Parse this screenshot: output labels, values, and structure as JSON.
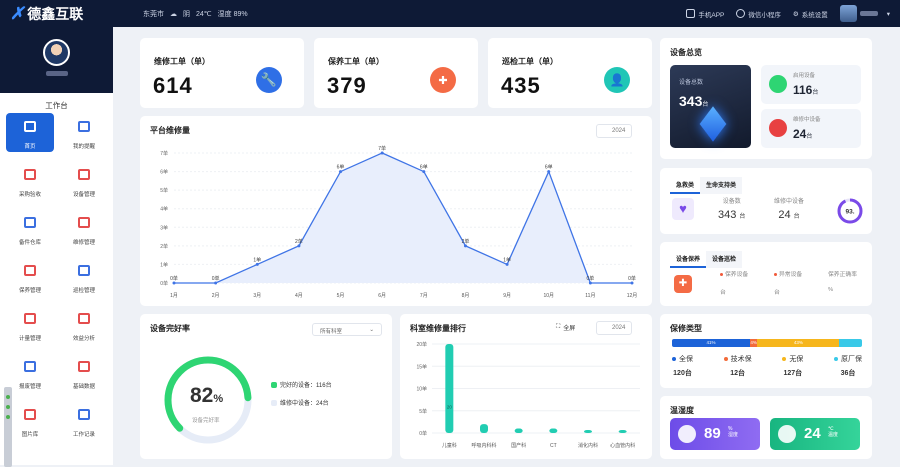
{
  "header": {
    "brand": "德鑫互联",
    "city": "东莞市",
    "weather": "阴",
    "temp": "24℃",
    "humidity": "湿度 89%",
    "app": "手机APP",
    "mini": "微信小程序",
    "settings": "系统设置"
  },
  "sidebar": {
    "workbench": "工作台",
    "items": [
      {
        "label": "首页",
        "icon": "home-icon"
      },
      {
        "label": "我的提醒",
        "icon": "alarm-icon"
      },
      {
        "label": "采购验收",
        "icon": "clipboard-check-icon"
      },
      {
        "label": "设备管理",
        "icon": "device-icon"
      },
      {
        "label": "备件仓库",
        "icon": "warehouse-icon"
      },
      {
        "label": "维修管理",
        "icon": "repair-icon"
      },
      {
        "label": "保养管理",
        "icon": "maintenance-icon"
      },
      {
        "label": "巡检管理",
        "icon": "inspection-icon"
      },
      {
        "label": "计量管理",
        "icon": "meter-icon"
      },
      {
        "label": "效益分析",
        "icon": "analysis-icon"
      },
      {
        "label": "报废管理",
        "icon": "scrap-icon"
      },
      {
        "label": "基础数据",
        "icon": "database-icon"
      },
      {
        "label": "图片库",
        "icon": "gallery-icon"
      },
      {
        "label": "工作记录",
        "icon": "record-icon"
      }
    ]
  },
  "kpis": [
    {
      "label": "维修工单（单）",
      "value": "614",
      "color": "#2f6fe6"
    },
    {
      "label": "保养工单（单）",
      "value": "379",
      "color": "#f46b45"
    },
    {
      "label": "巡检工单（单）",
      "value": "435",
      "color": "#20c6b6"
    }
  ],
  "repair_chart": {
    "title": "平台维修量",
    "year": "2024",
    "ylabels": [
      "0单",
      "1单",
      "2单",
      "3单",
      "4单",
      "5单",
      "6单",
      "7单"
    ]
  },
  "chart_data": [
    {
      "type": "area",
      "title": "平台维修量",
      "categories": [
        "1月",
        "2月",
        "3月",
        "4月",
        "5月",
        "6月",
        "7月",
        "8月",
        "9月",
        "10月",
        "11月",
        "12月"
      ],
      "values": [
        0,
        0,
        1,
        2,
        6,
        7,
        6,
        2,
        1,
        6,
        0,
        0
      ],
      "unit": "单",
      "ylim": [
        0,
        7
      ]
    },
    {
      "type": "bar",
      "title": "科室维修量排行",
      "categories": [
        "儿童科",
        "呼吸内科科",
        "国产科",
        "CT",
        "消化内科",
        "心血管内科"
      ],
      "values": [
        20,
        2,
        1,
        1,
        0,
        0
      ],
      "ylim": [
        0,
        20
      ]
    }
  ],
  "dept_chart": {
    "title": "科室维修量排行",
    "fullscreen": "全屏",
    "year": "2024",
    "ylabels": [
      "0单",
      "5单",
      "10单",
      "15单",
      "20单"
    ],
    "bar_label": "20"
  },
  "health": {
    "title": "设备完好率",
    "select": "所有科室",
    "value": "82",
    "unit": "%",
    "sub": "设备完好率",
    "legend": [
      {
        "label": "完好的设备：116台",
        "color": "#2ed573"
      },
      {
        "label": "维修中设备：24台",
        "color": "#e6ecf7"
      }
    ]
  },
  "overview": {
    "title": "设备总览",
    "total_label": "设备总数",
    "total": "343",
    "unit": "台",
    "enabled_label": "启用设备",
    "enabled": "116",
    "repair_label": "维修中设备",
    "repairing": "24"
  },
  "emergency": {
    "tabs": [
      "急救类",
      "生命支持类"
    ],
    "count_label": "设备数",
    "count": "343",
    "repair_label": "维修中设备",
    "repair": "24",
    "unit": "台",
    "ring": "93."
  },
  "maint": {
    "tabs": [
      "设备保养",
      "设备巡检"
    ],
    "labels": [
      "保养设备",
      "异常设备",
      "保养正确率"
    ],
    "units": [
      "台",
      "台",
      "%"
    ]
  },
  "guarantee": {
    "title": "保修类型",
    "bar": [
      {
        "pct": "41%",
        "color": "#1d63d8",
        "w": 41
      },
      {
        "pct": "4%",
        "color": "#f26b3a",
        "w": 4
      },
      {
        "pct": "43%",
        "color": "#f6b61d",
        "w": 43
      },
      {
        "pct": "",
        "color": "#39c9e8",
        "w": 12
      }
    ],
    "items": [
      {
        "name": "全保",
        "value": "120台",
        "color": "#1d63d8"
      },
      {
        "name": "技术保",
        "value": "12台",
        "color": "#f26b3a"
      },
      {
        "name": "无保",
        "value": "127台",
        "color": "#f6b61d"
      },
      {
        "name": "原厂保",
        "value": "36台",
        "color": "#39c9e8"
      }
    ]
  },
  "env": {
    "title": "温湿度",
    "humidity": "89",
    "hum_unit": "%",
    "hum_label": "湿度",
    "temp": "24",
    "temp_unit": "℃",
    "temp_label": "温度"
  }
}
